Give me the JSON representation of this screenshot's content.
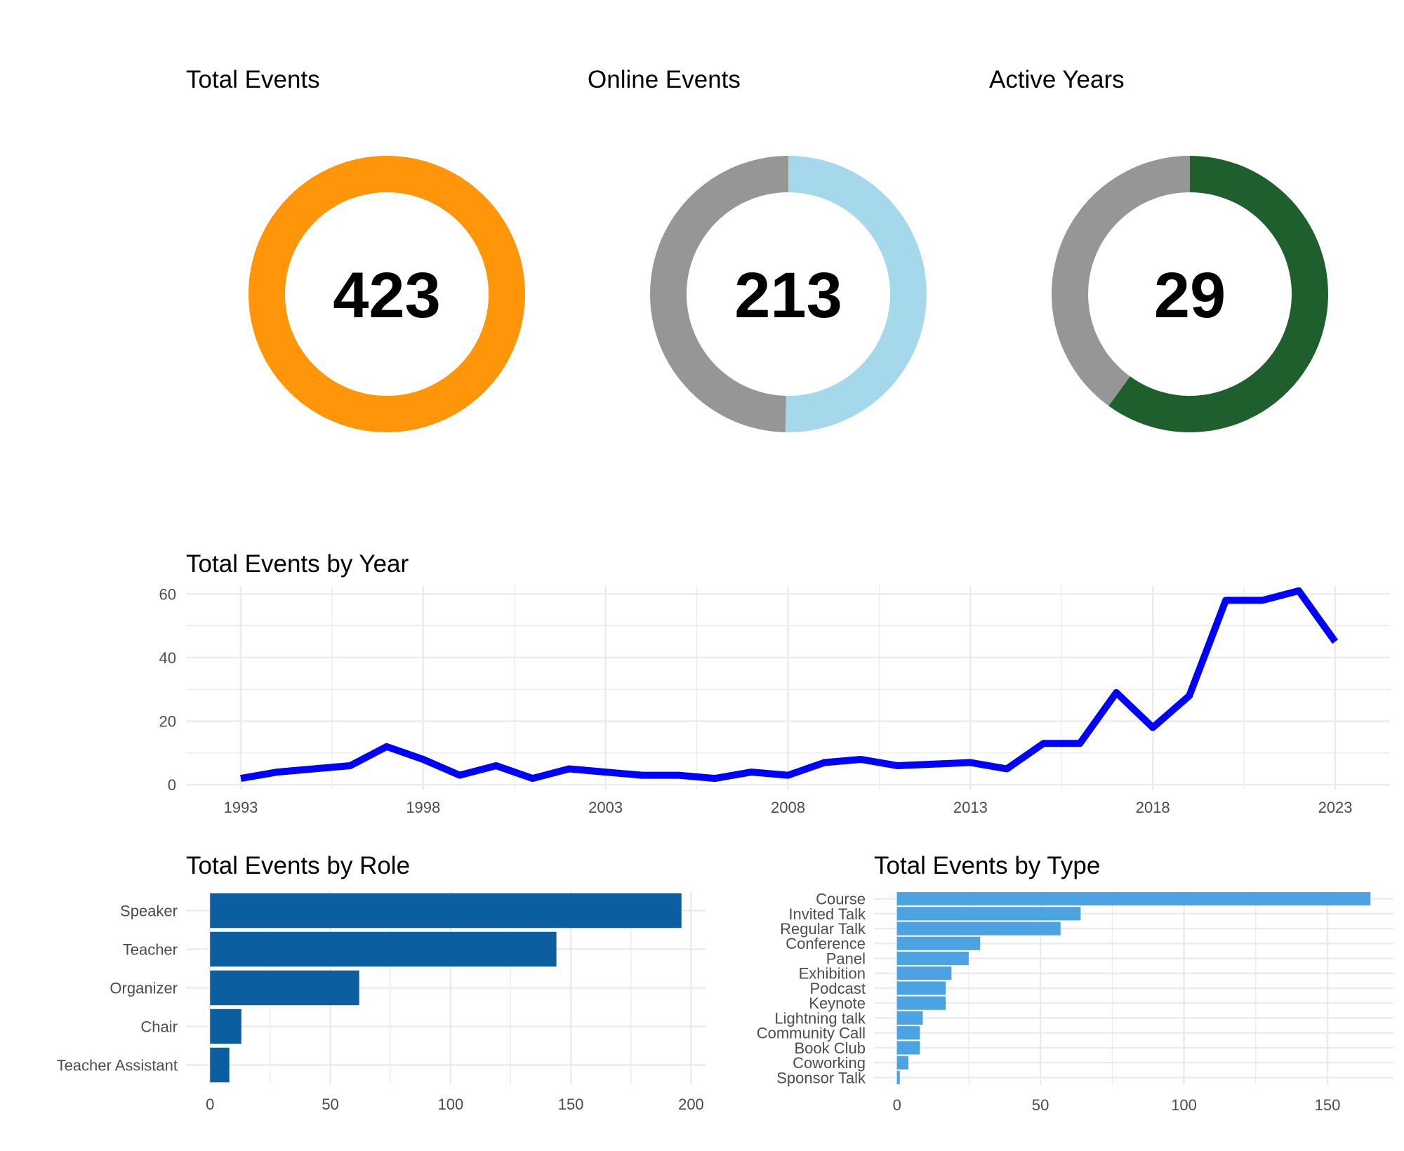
{
  "colors": {
    "total_events": "#FF9609",
    "online_events": "#A6D8EB",
    "active_years": "#1F5F2E",
    "remainder": "#969696",
    "line": "#0000FF",
    "role_bars": "#0B5FA1",
    "type_bars": "#4BA3E2",
    "grid": "#EBEBEB"
  },
  "chart_data": [
    {
      "type": "pie",
      "subtype": "donut",
      "title": "Total Events",
      "center_value": "423",
      "fraction": 1.0,
      "color": "#FF9609"
    },
    {
      "type": "pie",
      "subtype": "donut",
      "title": "Online Events",
      "center_value": "213",
      "fraction": 0.5035,
      "color": "#A6D8EB"
    },
    {
      "type": "pie",
      "subtype": "donut",
      "title": "Active Years",
      "center_value": "29",
      "fraction": 0.6,
      "color": "#1F5F2E"
    },
    {
      "type": "line",
      "title": "Total Events by Year",
      "x": [
        1993,
        1994,
        1995,
        1996,
        1997,
        1998,
        1999,
        2000,
        2001,
        2002,
        2003,
        2004,
        2005,
        2006,
        2007,
        2008,
        2009,
        2010,
        2011,
        2012,
        2013,
        2014,
        2015,
        2016,
        2017,
        2018,
        2019,
        2020,
        2021,
        2022,
        2023
      ],
      "y": [
        2,
        4,
        5,
        6,
        12,
        8,
        3,
        6,
        2,
        5,
        4,
        3,
        3,
        2,
        4,
        3,
        7,
        8,
        6,
        6.5,
        7,
        5,
        13,
        13,
        29,
        18,
        28,
        58,
        58,
        61,
        45
      ],
      "xticks": [
        "1993",
        "1998",
        "2003",
        "2008",
        "2013",
        "2018",
        "2023"
      ],
      "yticks": [
        "0",
        "20",
        "40",
        "60"
      ],
      "xlim": [
        1991.5,
        2024.5
      ],
      "ylim": [
        -1.5,
        62.5
      ],
      "grid": true
    },
    {
      "type": "bar",
      "orientation": "horizontal",
      "title": "Total Events by Role",
      "categories": [
        "Speaker",
        "Teacher",
        "Organizer",
        "Chair",
        "Teacher Assistant"
      ],
      "values": [
        196,
        144,
        62,
        13,
        8
      ],
      "xticks": [
        "0",
        "50",
        "100",
        "150",
        "200"
      ],
      "xlim": [
        -10,
        206
      ],
      "grid": true
    },
    {
      "type": "bar",
      "orientation": "horizontal",
      "title": "Total Events by Type",
      "categories": [
        "Course",
        "Invited Talk",
        "Regular Talk",
        "Conference",
        "Panel",
        "Exhibition",
        "Podcast",
        "Keynote",
        "Lightning talk",
        "Community Call",
        "Book Club",
        "Coworking",
        "Sponsor Talk"
      ],
      "values": [
        165,
        64,
        57,
        29,
        25,
        19,
        17,
        17,
        9,
        8,
        8,
        4,
        1
      ],
      "xticks": [
        "0",
        "50",
        "100",
        "150"
      ],
      "xlim": [
        -8,
        173
      ],
      "grid": true
    }
  ]
}
